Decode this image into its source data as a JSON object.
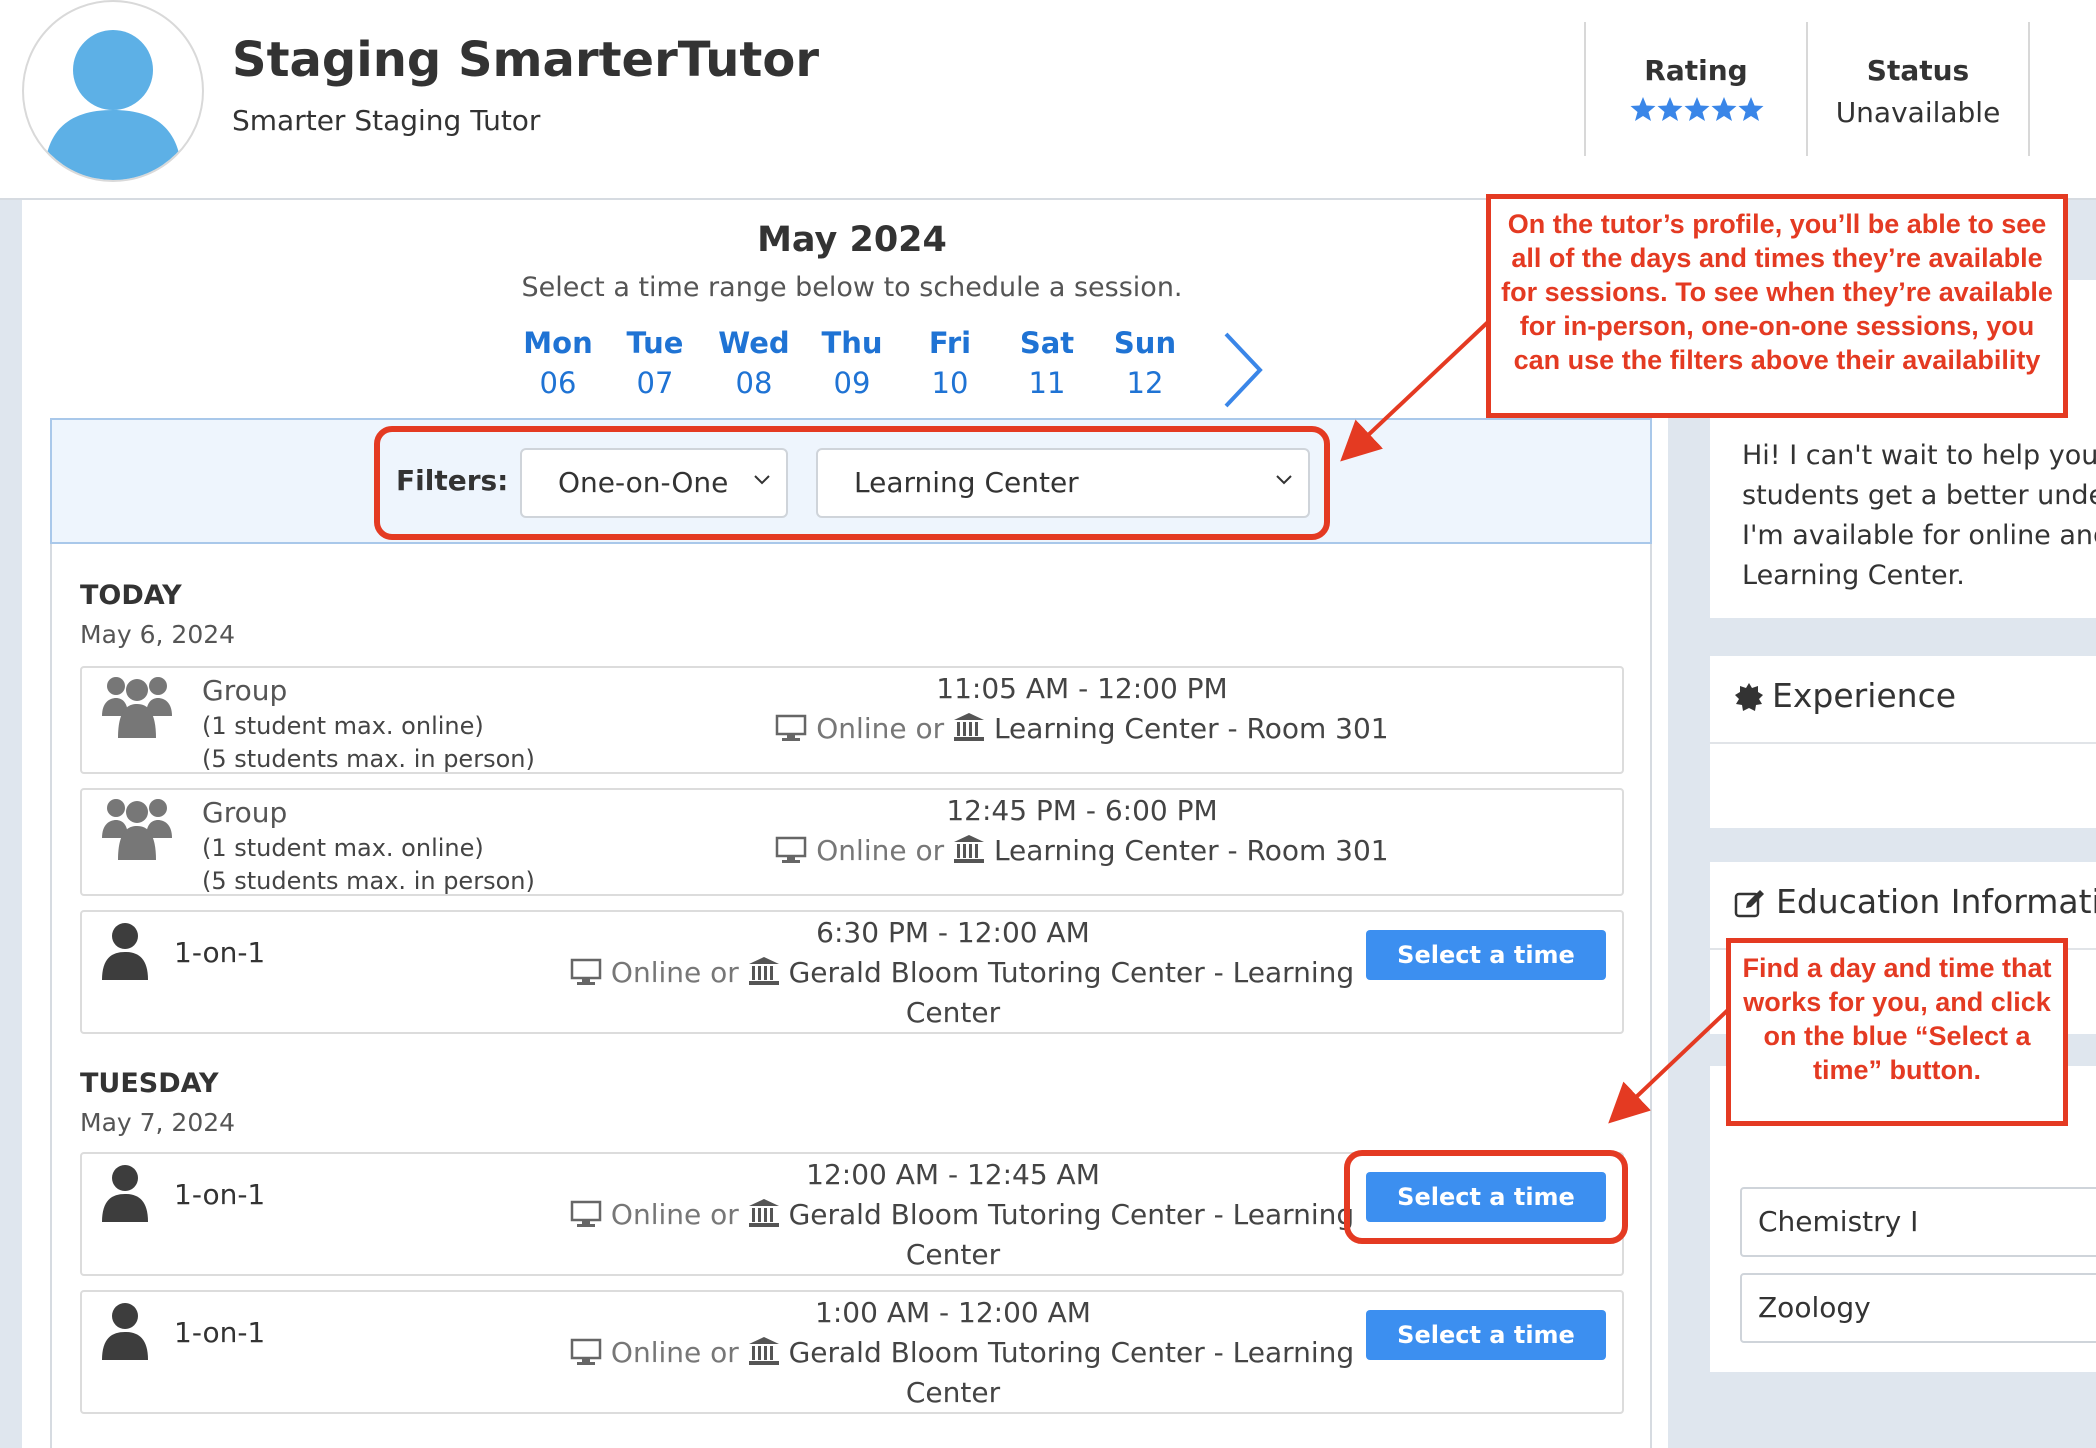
{
  "header": {
    "tutor_name": "Staging SmarterTutor",
    "tutor_subtitle": "Smarter Staging Tutor",
    "rating_label": "Rating",
    "rating_value": 5,
    "rating_max": 5,
    "status_label": "Status",
    "status_value": "Unavailable"
  },
  "calendar": {
    "month": "May 2024",
    "subtitle": "Select a time range below to schedule a session.",
    "days": [
      {
        "name": "Mon",
        "date": "06"
      },
      {
        "name": "Tue",
        "date": "07"
      },
      {
        "name": "Wed",
        "date": "08"
      },
      {
        "name": "Thu",
        "date": "09"
      },
      {
        "name": "Fri",
        "date": "10"
      },
      {
        "name": "Sat",
        "date": "11"
      },
      {
        "name": "Sun",
        "date": "12"
      }
    ]
  },
  "filters": {
    "label": "Filters:",
    "session_type": "One-on-One",
    "location": "Learning Center"
  },
  "schedule": {
    "today": {
      "heading": "TODAY",
      "date": "May 6, 2024",
      "slots": [
        {
          "kind": "Group",
          "online_max": "(1 student max. online)",
          "inperson_max": "(5 students max. in person)",
          "time": "11:05 AM - 12:00 PM",
          "online_text": "Online or",
          "location": "Learning Center - Room 301"
        },
        {
          "kind": "Group",
          "online_max": "(1 student max. online)",
          "inperson_max": "(5 students max. in person)",
          "time": "12:45 PM - 6:00 PM",
          "online_text": "Online or",
          "location": "Learning Center - Room 301"
        },
        {
          "kind": "1-on-1",
          "time": "6:30 PM - 12:00 AM",
          "online_text": "Online or",
          "location_line1": "Gerald Bloom Tutoring Center - Learning",
          "location_line2": "Center",
          "button": "Select a time"
        }
      ]
    },
    "tuesday": {
      "heading": "TUESDAY",
      "date": "May 7, 2024",
      "slots": [
        {
          "kind": "1-on-1",
          "time": "12:00 AM - 12:45 AM",
          "online_text": "Online or",
          "location_line1": "Gerald Bloom Tutoring Center - Learning",
          "location_line2": "Center",
          "button": "Select a time"
        },
        {
          "kind": "1-on-1",
          "time": "1:00 AM - 12:00 AM",
          "online_text": "Online or",
          "location_line1": "Gerald Bloom Tutoring Center - Learning",
          "location_line2": "Center",
          "button": "Select a time"
        }
      ]
    }
  },
  "sidebar": {
    "bio_lines": [
      "Hi! I can't wait to help you i",
      "students get a better under",
      "I'm available for online and",
      "Learning Center."
    ],
    "experience_title": "Experience",
    "education_title": "Education Informatio",
    "subjects": [
      "Chemistry I",
      "Zoology"
    ]
  },
  "annotations": {
    "callout_top": "On the tutor’s profile, you’ll be able to see all of the days and times they’re available for sessions. To see when they’re available for in-person, one-on-one sessions, you can use the filters above their availability",
    "callout_bottom": "Find a day and time that works for you, and click on the blue “Select a time” button."
  },
  "colors": {
    "accent_blue": "#1f73d4",
    "button_blue": "#3c8ff0",
    "annotation_red": "#e43a22",
    "filter_bar_bg": "#eef5fd"
  }
}
